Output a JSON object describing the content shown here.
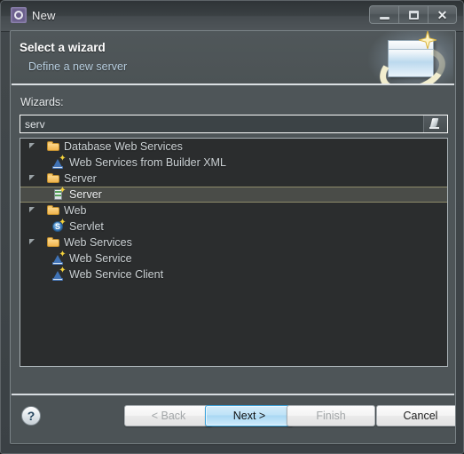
{
  "window": {
    "title": "New",
    "app_icon": "gear-icon",
    "controls": {
      "minimize": "minimize-icon",
      "maximize": "maximize-icon",
      "close": "close-icon",
      "close_glyph": "✕"
    }
  },
  "header": {
    "title": "Select a wizard",
    "subtitle": "Define a new server",
    "banner_icon": "wizard-page-icon"
  },
  "filter": {
    "label": "Wizards:",
    "value": "serv",
    "placeholder": "",
    "button_icon": "clear-filter-icon"
  },
  "tree": {
    "items": [
      {
        "label": "Database Web Services",
        "icon": "folder-icon",
        "level": 0,
        "expanded": true,
        "selected": false
      },
      {
        "label": "Web Services from Builder XML",
        "icon": "wizard-hat-icon",
        "level": 1,
        "expanded": null,
        "selected": false
      },
      {
        "label": "Server",
        "icon": "folder-icon",
        "level": 0,
        "expanded": true,
        "selected": false
      },
      {
        "label": "Server",
        "icon": "server-icon",
        "level": 1,
        "expanded": null,
        "selected": true
      },
      {
        "label": "Web",
        "icon": "folder-icon",
        "level": 0,
        "expanded": true,
        "selected": false
      },
      {
        "label": "Servlet",
        "icon": "servlet-icon",
        "level": 1,
        "expanded": null,
        "selected": false
      },
      {
        "label": "Web Services",
        "icon": "folder-icon",
        "level": 0,
        "expanded": true,
        "selected": false
      },
      {
        "label": "Web Service",
        "icon": "wizard-hat-icon",
        "level": 1,
        "expanded": null,
        "selected": false
      },
      {
        "label": "Web Service Client",
        "icon": "wizard-hat-icon",
        "level": 1,
        "expanded": null,
        "selected": false
      }
    ]
  },
  "buttons": {
    "help": "?",
    "back": "< Back",
    "next": "Next >",
    "finish": "Finish",
    "cancel": "Cancel"
  },
  "colors": {
    "window_bg": "#43494c",
    "panel_bg": "#4e5558",
    "tree_bg": "#2b2d2e",
    "accent_link": "#b9cfe0",
    "selection_border": "#8e8b6a",
    "primary_button": "#a9d8f3"
  }
}
